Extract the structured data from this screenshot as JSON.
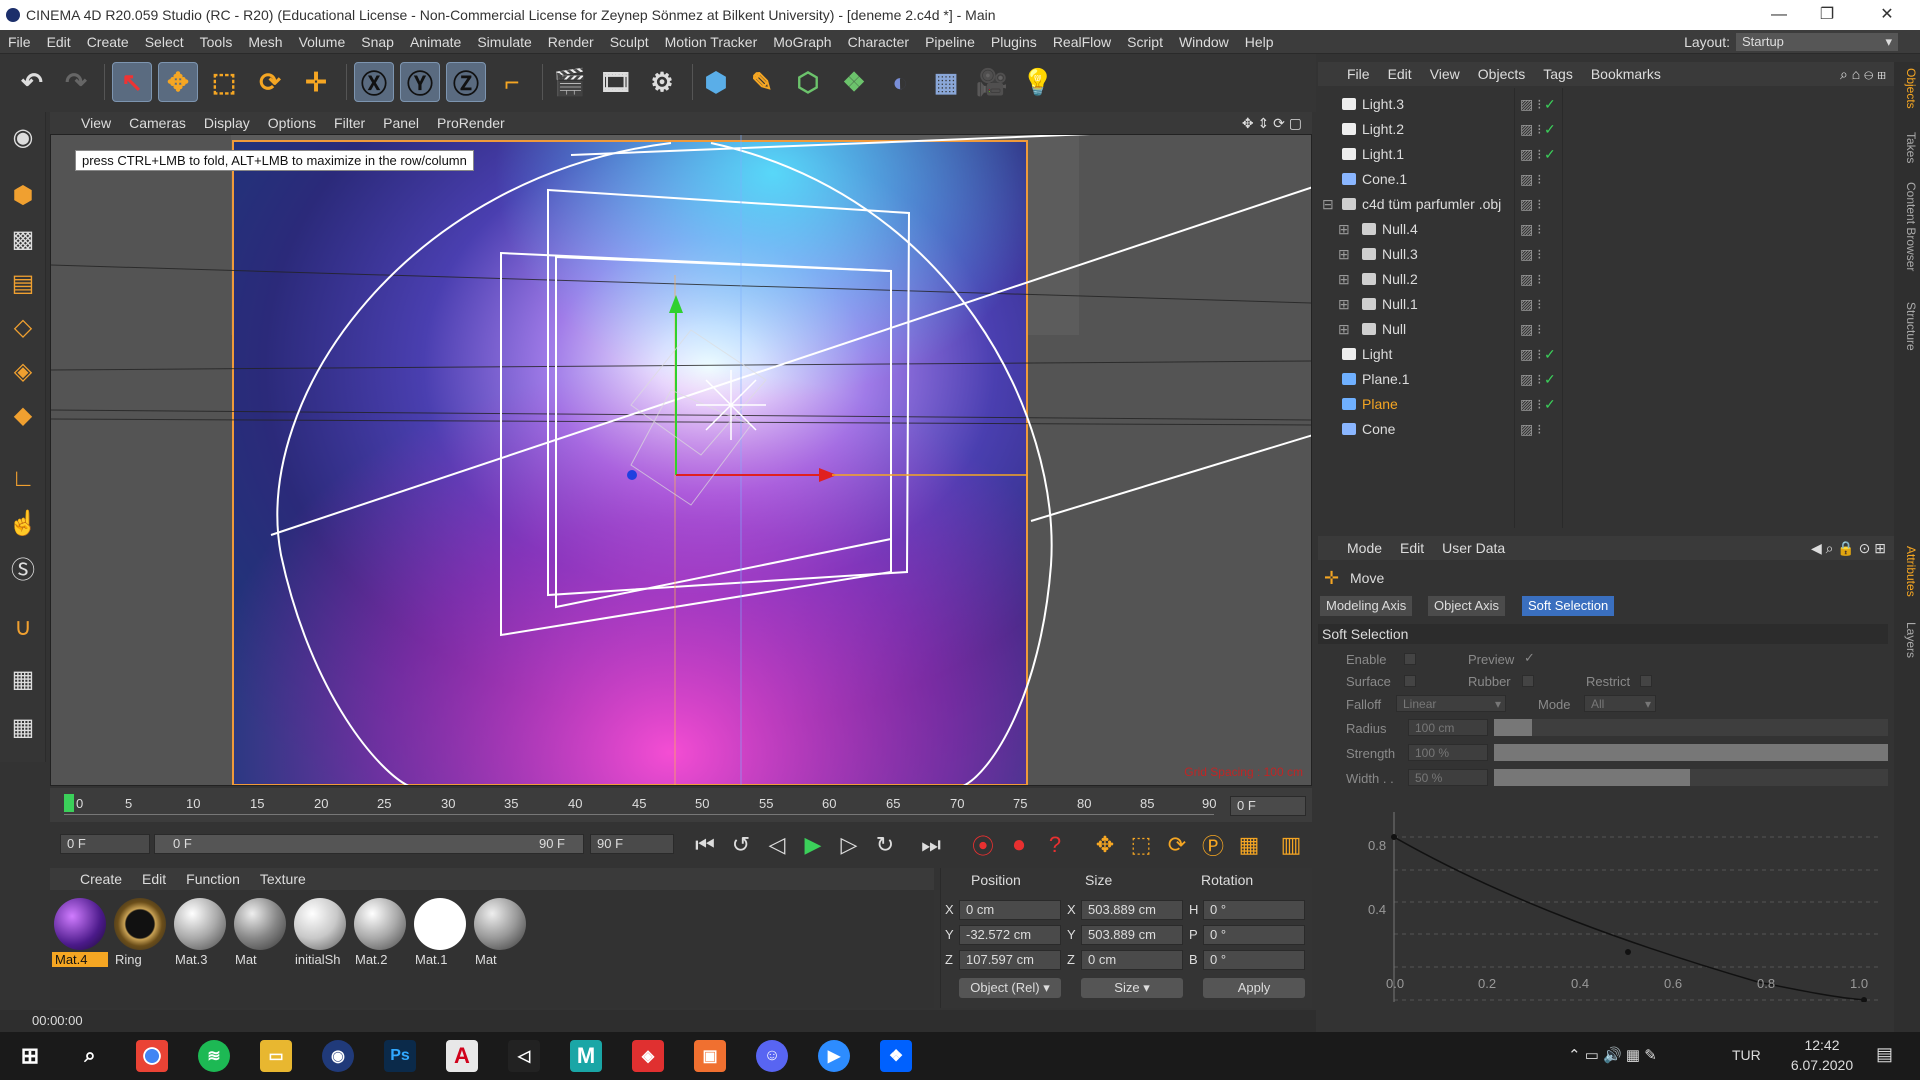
{
  "window": {
    "title": "CINEMA 4D R20.059 Studio (RC - R20) (Educational License - Non-Commercial License for Zeynep  Sönmez at Bilkent University) - [deneme 2.c4d *] - Main"
  },
  "menubar": {
    "items": [
      "File",
      "Edit",
      "Create",
      "Select",
      "Tools",
      "Mesh",
      "Volume",
      "Snap",
      "Animate",
      "Simulate",
      "Render",
      "Sculpt",
      "Motion Tracker",
      "MoGraph",
      "Character",
      "Pipeline",
      "Plugins",
      "RealFlow",
      "Script",
      "Window",
      "Help"
    ],
    "layout_label": "Layout:",
    "layout_value": "Startup"
  },
  "viewport": {
    "menu": [
      "View",
      "Cameras",
      "Display",
      "Options",
      "Filter",
      "Panel",
      "ProRender"
    ],
    "tooltip": "press CTRL+LMB to fold, ALT+LMB to maximize in the row/column",
    "grid_spacing": "Grid Spacing : 100 cm"
  },
  "timeline": {
    "ticks": [
      "0",
      "5",
      "10",
      "15",
      "20",
      "25",
      "30",
      "35",
      "40",
      "45",
      "50",
      "55",
      "60",
      "65",
      "70",
      "75",
      "80",
      "85",
      "90"
    ],
    "current_frame": "0 F"
  },
  "transport": {
    "start": "0 F",
    "range_start": "0 F",
    "range_end": "90 F",
    "end": "90 F"
  },
  "materials": {
    "menu": [
      "Create",
      "Edit",
      "Function",
      "Texture"
    ],
    "items": [
      {
        "name": "Mat.4",
        "color": "#6a2fb0"
      },
      {
        "name": "Ring",
        "color": "#c9a255"
      },
      {
        "name": "Mat.3",
        "color": "#b8b8b8"
      },
      {
        "name": "Mat",
        "color": "#9a9a9a"
      },
      {
        "name": "initialSh",
        "color": "#c8c8c8"
      },
      {
        "name": "Mat.2",
        "color": "#b5b5b5"
      },
      {
        "name": "Mat.1",
        "color": "#ffffff"
      },
      {
        "name": "Mat",
        "color": "#a0a0a0"
      }
    ]
  },
  "coordinates": {
    "headers": {
      "position": "Position",
      "size": "Size",
      "rotation": "Rotation"
    },
    "rows": [
      {
        "axis": "X",
        "pos": "0 cm",
        "size_axis": "X",
        "size": "503.889 cm",
        "rot_axis": "H",
        "rot": "0 °"
      },
      {
        "axis": "Y",
        "pos": "-32.572 cm",
        "size_axis": "Y",
        "size": "503.889 cm",
        "rot_axis": "P",
        "rot": "0 °"
      },
      {
        "axis": "Z",
        "pos": "107.597 cm",
        "size_axis": "Z",
        "size": "0 cm",
        "rot_axis": "B",
        "rot": "0 °"
      }
    ],
    "mode": "Object (Rel)",
    "size_mode": "Size",
    "apply": "Apply"
  },
  "status": {
    "time": "00:00:00"
  },
  "object_manager": {
    "menu": [
      "File",
      "Edit",
      "View",
      "Objects",
      "Tags",
      "Bookmarks"
    ],
    "objects": [
      {
        "name": "Light.3",
        "indent": 0,
        "icon": "light",
        "checked": true
      },
      {
        "name": "Light.2",
        "indent": 0,
        "icon": "light",
        "checked": true
      },
      {
        "name": "Light.1",
        "indent": 0,
        "icon": "light",
        "checked": true
      },
      {
        "name": "Cone.1",
        "indent": 0,
        "icon": "cone",
        "checked": false
      },
      {
        "name": "c4d tüm parfumler .obj",
        "indent": 0,
        "icon": "null",
        "checked": false
      },
      {
        "name": "Null.4",
        "indent": 1,
        "icon": "null",
        "checked": false
      },
      {
        "name": "Null.3",
        "indent": 1,
        "icon": "null",
        "checked": false
      },
      {
        "name": "Null.2",
        "indent": 1,
        "icon": "null",
        "checked": false
      },
      {
        "name": "Null.1",
        "indent": 1,
        "icon": "null",
        "checked": false
      },
      {
        "name": "Null",
        "indent": 1,
        "icon": "null",
        "checked": false
      },
      {
        "name": "Light",
        "indent": 0,
        "icon": "light",
        "checked": true
      },
      {
        "name": "Plane.1",
        "indent": 0,
        "icon": "plane",
        "checked": true
      },
      {
        "name": "Plane",
        "indent": 0,
        "icon": "plane",
        "checked": true,
        "highlight": true
      },
      {
        "name": "Cone",
        "indent": 0,
        "icon": "cone",
        "checked": false
      }
    ]
  },
  "side_tabs": [
    "Objects",
    "Takes",
    "Content Browser",
    "Structure",
    "Attributes",
    "Layers"
  ],
  "attributes": {
    "menu": [
      "Mode",
      "Edit",
      "User Data"
    ],
    "tool": "Move",
    "tabs": [
      "Modeling Axis",
      "Object Axis",
      "Soft Selection"
    ],
    "section": "Soft Selection",
    "enable": "Enable",
    "preview": "Preview",
    "surface": "Surface",
    "rubber": "Rubber",
    "restrict": "Restrict",
    "falloff_label": "Falloff",
    "falloff": "Linear",
    "mode_label": "Mode",
    "mode": "All",
    "radius_label": "Radius",
    "radius": "100 cm",
    "strength_label": "Strength",
    "strength": "100 %",
    "width_label": "Width . .",
    "width": "50 %",
    "graph_y": [
      "0.8",
      "0.4",
      "0.0"
    ],
    "graph_x": [
      "0.2",
      "0.4",
      "0.6",
      "0.8",
      "1.0"
    ]
  },
  "taskbar": {
    "apps": [
      "Start",
      "Search",
      "Chrome",
      "Spotify",
      "Files",
      "Cinema 4D",
      "Photoshop",
      "Acrobat",
      "Unity",
      "Maya",
      "Settings",
      "Screen",
      "Discord",
      "Zoom",
      "Dropbox"
    ],
    "lang": "TUR",
    "time": "12:42",
    "date": "6.07.2020"
  }
}
